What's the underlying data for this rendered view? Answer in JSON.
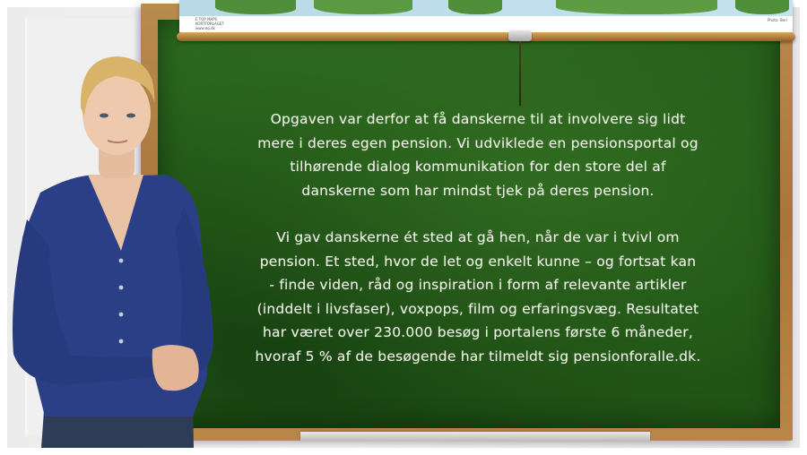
{
  "map": {
    "caption_left": "E TOP MAPS\nKORTFORLAGET\nwww.eq.dk\n\nFra kort til kort",
    "caption_right": "Photo: Beri"
  },
  "board": {
    "paragraph_1": "Opgaven var derfor at få danskerne til at involvere sig lidt\nmere i deres egen pension. Vi udviklede en pensionsportal og\ntilhørende dialog kommunikation for den store del af\ndanskerne som har mindst tjek på deres pension.",
    "paragraph_2": "Vi gav danskerne ét sted at gå hen, når de var i tvivl om\npension. Et sted, hvor de let og enkelt kunne – og fortsat kan\n- finde viden, råd og inspiration i form af relevante artikler\n(inddelt i livsfaser), voxpops, film og erfaringsvæg. Resultatet\nhar været over 230.000 besøg i portalens første 6 måneder,\nhvoraf 5 % af de besøgende har tilmeldt sig pensionforalle.dk."
  },
  "colors": {
    "board_green": "#245c18",
    "frame_wood": "#a8763a",
    "chalk_text": "#f0f2e8",
    "cardigan_blue": "#2b3f86"
  }
}
